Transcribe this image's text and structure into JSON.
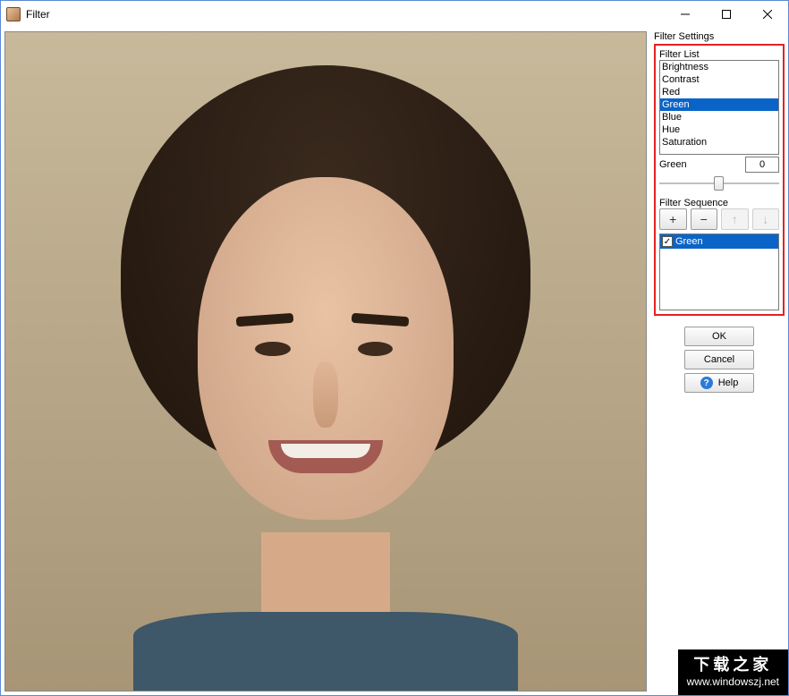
{
  "window": {
    "title": "Filter"
  },
  "panel": {
    "settings_label": "Filter Settings",
    "list_label": "Filter List",
    "filters": [
      "Brightness",
      "Contrast",
      "Red",
      "Green",
      "Blue",
      "Hue",
      "Saturation"
    ],
    "selected_filter_index": 3,
    "value_label": "Green",
    "value": "0",
    "sequence_label": "Filter Sequence",
    "seq_buttons": {
      "add": "+",
      "remove": "−",
      "up": "↑",
      "down": "↓"
    },
    "sequence": [
      {
        "name": "Green",
        "checked": true
      }
    ]
  },
  "buttons": {
    "ok": "OK",
    "cancel": "Cancel",
    "help": "Help"
  },
  "watermark": {
    "cn": "下载之家",
    "url": "www.windowszj.net"
  }
}
